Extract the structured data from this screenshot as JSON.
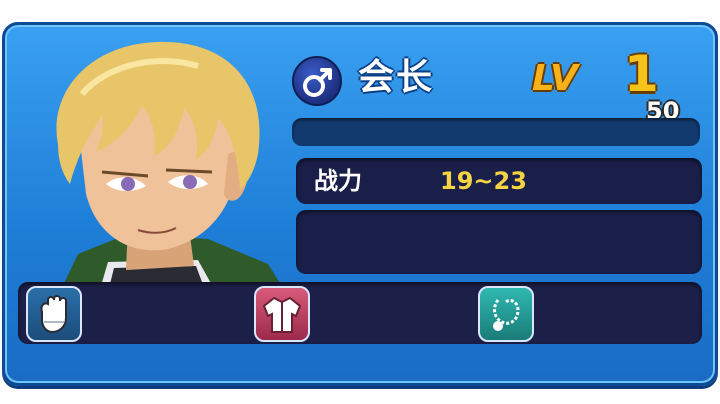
{
  "character": {
    "name": "会长",
    "gender_icon": "male-symbol-icon",
    "level_label": "LV",
    "level_value": "1",
    "level_max": "50",
    "exp_fraction": 0.0
  },
  "stats": {
    "power_label": "战力",
    "power_value": "19~23"
  },
  "equipment": [
    {
      "slot": "gloves",
      "icon": "glove-icon"
    },
    {
      "slot": "armor",
      "icon": "jacket-icon"
    },
    {
      "slot": "accessory",
      "icon": "necklace-icon"
    }
  ],
  "colors": {
    "frame": "#1e7fd8",
    "panel": "#1a1f4a",
    "level_gold": "#f5b21c",
    "power_value": "#f5d343"
  }
}
